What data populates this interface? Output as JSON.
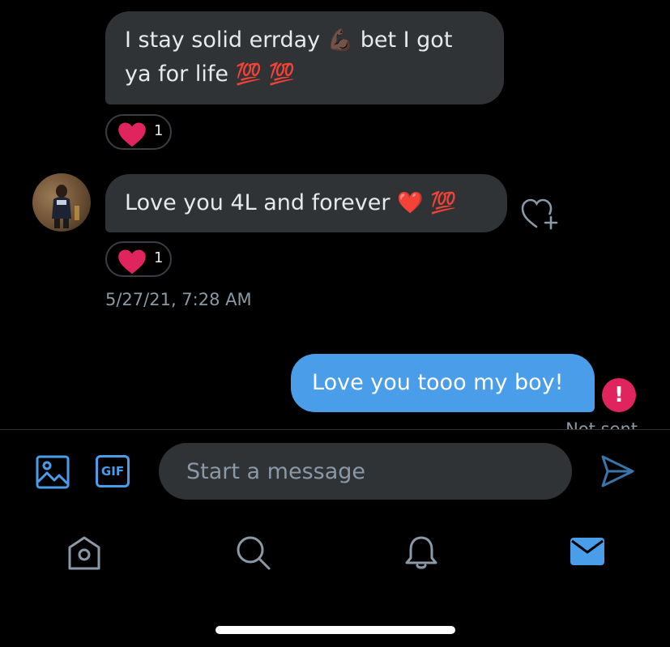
{
  "messages": [
    {
      "direction": "incoming",
      "line1": "I stay solid errday",
      "emoji_flex": "💪🏿",
      "line1_tail": " bet I got",
      "line2": "ya for life ",
      "emoji_100a": "💯",
      "emoji_100b": "💯",
      "reaction": {
        "emoji": "heart-icon",
        "count": "1"
      }
    },
    {
      "direction": "incoming",
      "text": "Love you 4L and forever ",
      "emoji_heart": "❤️",
      "emoji_100": "💯",
      "reaction": {
        "emoji": "heart-icon",
        "count": "1"
      }
    },
    {
      "direction": "outgoing",
      "text": "Love you tooo my boy!",
      "status": "Not sent"
    }
  ],
  "timestamp": "5/27/21, 7:28 AM",
  "error_icon_glyph": "!",
  "composer": {
    "gif_label": "GIF",
    "placeholder": "Start a message"
  },
  "nav": [
    "home-icon",
    "search-icon",
    "notifications-icon",
    "messages-icon"
  ],
  "colors": {
    "background": "#000000",
    "incoming_bubble": "#2f3336",
    "outgoing_bubble": "#4a9de8",
    "accent": "#4a9de8",
    "heart": "#e0245e",
    "muted_text": "#8b98a5"
  }
}
